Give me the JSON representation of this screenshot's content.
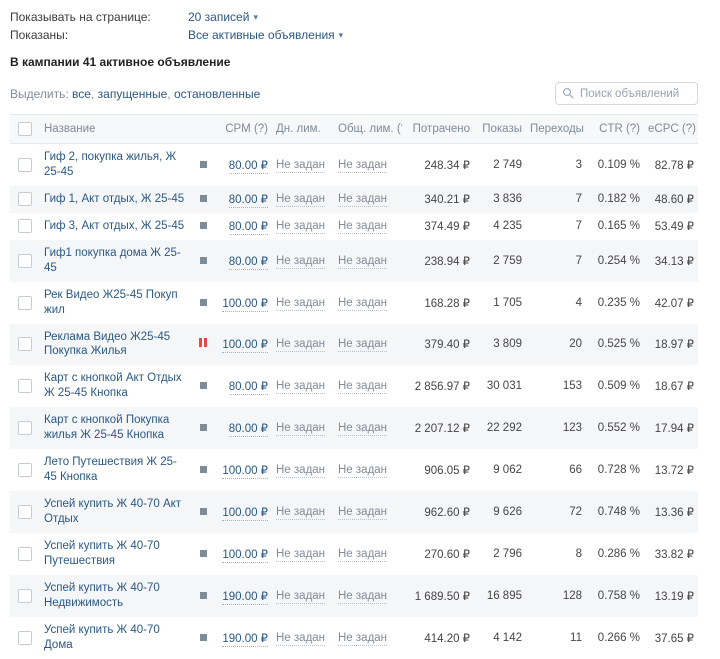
{
  "controls": {
    "per_page_label": "Показывать на странице:",
    "per_page_value": "20 записей",
    "shown_label": "Показаны:",
    "shown_value": "Все активные объявления",
    "campaign_summary": "В кампании 41 активное объявление",
    "select_label": "Выделить:",
    "select_links": [
      "все",
      "запущенные",
      "остановленные"
    ],
    "search_placeholder": "Поиск объявлений"
  },
  "colors": {
    "link_blue": "#2a5885",
    "pause_red": "#e64646",
    "stop_gray": "#7d8b97",
    "row_stripe": "#f5f6f8",
    "header_text": "#7f8b99"
  },
  "table": {
    "headers": {
      "name": "Название",
      "cpm": "CPM (?)",
      "day_limit": "Дн. лим.",
      "total_limit": "Общ. лим. (?)",
      "spent": "Потрачено",
      "shows": "Показы",
      "clicks": "Переходы",
      "ctr": "CTR (?)",
      "ecpc": "eCPC (?)"
    },
    "rows": [
      {
        "name": "Гиф 2, покупка жилья, Ж 25-45",
        "status": "stopped",
        "cpm": "80.00 ₽",
        "day_limit": "Не задан",
        "total_limit": "Не задан",
        "spent": "248.34 ₽",
        "shows": "2 749",
        "clicks": "3",
        "ctr": "0.109 %",
        "ecpc": "82.78 ₽"
      },
      {
        "name": "Гиф 1, Акт отдых, Ж 25-45",
        "status": "stopped",
        "cpm": "80.00 ₽",
        "day_limit": "Не задан",
        "total_limit": "Не задан",
        "spent": "340.21 ₽",
        "shows": "3 836",
        "clicks": "7",
        "ctr": "0.182 %",
        "ecpc": "48.60 ₽"
      },
      {
        "name": "Гиф 3, Акт отдых, Ж 25-45",
        "status": "stopped",
        "cpm": "80.00 ₽",
        "day_limit": "Не задан",
        "total_limit": "Не задан",
        "spent": "374.49 ₽",
        "shows": "4 235",
        "clicks": "7",
        "ctr": "0.165 %",
        "ecpc": "53.49 ₽"
      },
      {
        "name": "Гиф1 покупка дома Ж 25-45",
        "status": "stopped",
        "cpm": "80.00 ₽",
        "day_limit": "Не задан",
        "total_limit": "Не задан",
        "spent": "238.94 ₽",
        "shows": "2 759",
        "clicks": "7",
        "ctr": "0.254 %",
        "ecpc": "34.13 ₽"
      },
      {
        "name": "Рек Видео Ж25-45 Покуп жил",
        "status": "stopped",
        "cpm": "100.00 ₽",
        "day_limit": "Не задан",
        "total_limit": "Не задан",
        "spent": "168.28 ₽",
        "shows": "1 705",
        "clicks": "4",
        "ctr": "0.235 %",
        "ecpc": "42.07 ₽"
      },
      {
        "name": "Реклама Видео Ж25-45 Покупка Жилья",
        "status": "paused",
        "cpm": "100.00 ₽",
        "day_limit": "Не задан",
        "total_limit": "Не задан",
        "spent": "379.40 ₽",
        "shows": "3 809",
        "clicks": "20",
        "ctr": "0.525 %",
        "ecpc": "18.97 ₽"
      },
      {
        "name": "Карт с кнопкой Акт Отдых Ж 25-45 Кнопка",
        "status": "stopped",
        "cpm": "80.00 ₽",
        "day_limit": "Не задан",
        "total_limit": "Не задан",
        "spent": "2 856.97 ₽",
        "shows": "30 031",
        "clicks": "153",
        "ctr": "0.509 %",
        "ecpc": "18.67 ₽"
      },
      {
        "name": "Карт с кнопкой Покупка жилья Ж 25-45 Кнопка",
        "status": "stopped",
        "cpm": "80.00 ₽",
        "day_limit": "Не задан",
        "total_limit": "Не задан",
        "spent": "2 207.12 ₽",
        "shows": "22 292",
        "clicks": "123",
        "ctr": "0.552 %",
        "ecpc": "17.94 ₽"
      },
      {
        "name": "Лето Путешествия Ж 25-45 Кнопка",
        "status": "stopped",
        "cpm": "100.00 ₽",
        "day_limit": "Не задан",
        "total_limit": "Не задан",
        "spent": "906.05 ₽",
        "shows": "9 062",
        "clicks": "66",
        "ctr": "0.728 %",
        "ecpc": "13.72 ₽"
      },
      {
        "name": "Успей купить Ж 40-70 Акт Отдых",
        "status": "stopped",
        "cpm": "100.00 ₽",
        "day_limit": "Не задан",
        "total_limit": "Не задан",
        "spent": "962.60 ₽",
        "shows": "9 626",
        "clicks": "72",
        "ctr": "0.748 %",
        "ecpc": "13.36 ₽"
      },
      {
        "name": "Успей купить Ж 40-70 Путешествия",
        "status": "stopped",
        "cpm": "100.00 ₽",
        "day_limit": "Не задан",
        "total_limit": "Не задан",
        "spent": "270.60 ₽",
        "shows": "2 796",
        "clicks": "8",
        "ctr": "0.286 %",
        "ecpc": "33.82 ₽"
      },
      {
        "name": "Успей купить Ж 40-70 Недвижимость",
        "status": "stopped",
        "cpm": "190.00 ₽",
        "day_limit": "Не задан",
        "total_limit": "Не задан",
        "spent": "1 689.50 ₽",
        "shows": "16 895",
        "clicks": "128",
        "ctr": "0.758 %",
        "ecpc": "13.19 ₽"
      },
      {
        "name": "Успей купить Ж 40-70 Дома",
        "status": "stopped",
        "cpm": "190.00 ₽",
        "day_limit": "Не задан",
        "total_limit": "Не задан",
        "spent": "414.20 ₽",
        "shows": "4 142",
        "clicks": "11",
        "ctr": "0.266 %",
        "ecpc": "37.65 ₽"
      }
    ]
  }
}
